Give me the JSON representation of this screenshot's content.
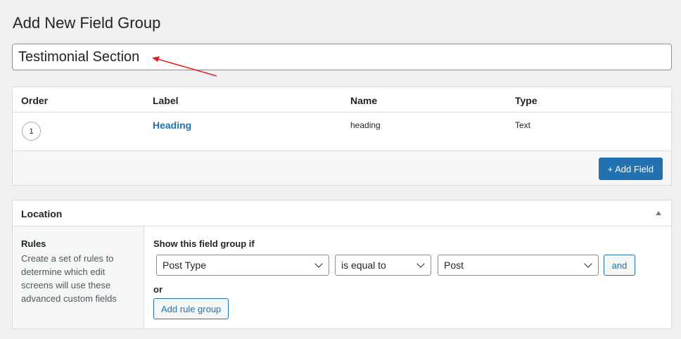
{
  "page": {
    "title": "Add New Field Group"
  },
  "title_input": {
    "value": "Testimonial Section"
  },
  "fields_table": {
    "headers": {
      "order": "Order",
      "label": "Label",
      "name": "Name",
      "type": "Type"
    },
    "rows": [
      {
        "order": "1",
        "label": "Heading",
        "name": "heading",
        "type": "Text"
      }
    ],
    "add_button": "+ Add Field"
  },
  "location": {
    "title": "Location",
    "rules_title": "Rules",
    "rules_description": "Create a set of rules to determine which edit screens will use these advanced custom fields",
    "show_if_label": "Show this field group if",
    "param_select": "Post Type",
    "operator_select": "is equal to",
    "value_select": "Post",
    "and_button": "and",
    "or_label": "or",
    "add_rule_group_button": "Add rule group"
  },
  "colors": {
    "accent": "#2271b1",
    "annotation_arrow": "#e02424"
  }
}
